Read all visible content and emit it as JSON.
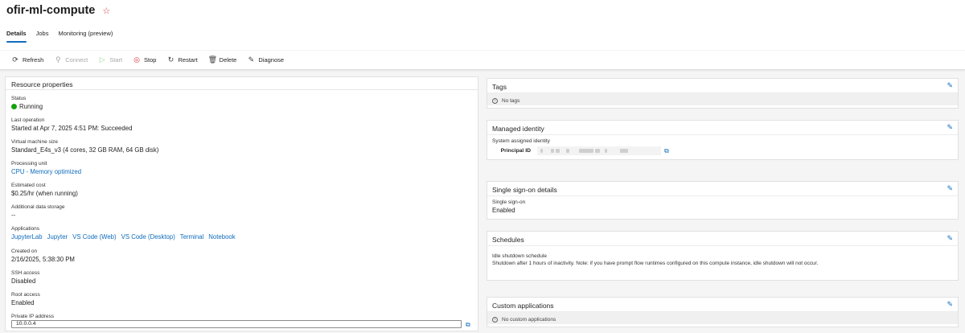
{
  "header": {
    "title": "ofir-ml-compute",
    "favorite_icon": "star-icon",
    "tabs": [
      {
        "label": "Details",
        "active": true
      },
      {
        "label": "Jobs",
        "active": false
      },
      {
        "label": "Monitoring (preview)",
        "active": false
      }
    ]
  },
  "toolbar": {
    "refresh": "Refresh",
    "connect": "Connect",
    "start": "Start",
    "stop": "Stop",
    "restart": "Restart",
    "delete": "Delete",
    "diagnose": "Diagnose"
  },
  "resource": {
    "title": "Resource properties",
    "status_label": "Status",
    "status_value": "Running",
    "last_op_label": "Last operation",
    "last_op_value": "Started at Apr 7, 2025 4:51 PM: Succeeded",
    "vm_label": "Virtual machine size",
    "vm_value": "Standard_E4s_v3 (4 cores, 32 GB RAM, 64 GB disk)",
    "pu_label": "Processing unit",
    "pu_value": "CPU - Memory optimized",
    "cost_label": "Estimated cost",
    "cost_value": "$0.25/hr (when running)",
    "storage_label": "Additional data storage",
    "storage_value": "--",
    "apps_label": "Applications",
    "apps": [
      "JupyterLab",
      "Jupyter",
      "VS Code (Web)",
      "VS Code (Desktop)",
      "Terminal",
      "Notebook"
    ],
    "created_label": "Created on",
    "created_value": "2/16/2025, 5:38:30 PM",
    "ssh_label": "SSH access",
    "ssh_value": "Disabled",
    "root_label": "Root access",
    "root_value": "Enabled",
    "ip_label": "Private IP address",
    "ip_value": "10.0.0.4"
  },
  "tags": {
    "title": "Tags",
    "empty": "No tags"
  },
  "identity": {
    "title": "Managed identity",
    "system_label": "System assigned identity",
    "principal_label": "Principal ID"
  },
  "sso": {
    "title": "Single sign-on details",
    "label": "Single sign-on",
    "value": "Enabled"
  },
  "schedules": {
    "title": "Schedules",
    "label": "Idle shutdown schedule",
    "value": "Shutdown after 1 hours of inactivity. Note: if you have prompt flow runtimes configured on this compute instance, idle shutdown will not occur."
  },
  "custom_apps": {
    "title": "Custom applications",
    "empty": "No custom applications"
  }
}
